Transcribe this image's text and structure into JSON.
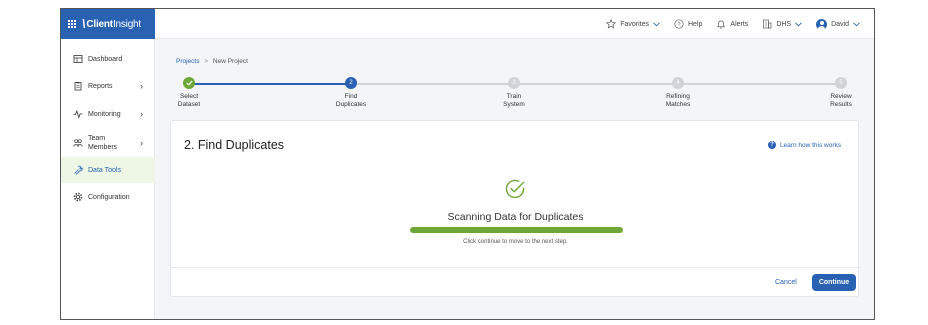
{
  "brand": {
    "name_bold": "Client",
    "name_light": "Insight"
  },
  "topnav": {
    "favorites": "Favorites",
    "help": "Help",
    "alerts": "Alerts",
    "org": "DHS",
    "user": "David"
  },
  "sidebar": {
    "items": [
      {
        "label": "Dashboard"
      },
      {
        "label": "Reports"
      },
      {
        "label": "Monitoring"
      },
      {
        "label_line1": "Team",
        "label_line2": "Members"
      },
      {
        "label": "Data Tools"
      },
      {
        "label": "Configuration"
      }
    ]
  },
  "breadcrumb": {
    "projects": "Projects",
    "sep": ">",
    "current": "New Project"
  },
  "stepper": {
    "steps": [
      {
        "number": "",
        "line1": "Select",
        "line2": "Dataset",
        "state": "done"
      },
      {
        "number": "2",
        "line1": "Find",
        "line2": "Duplicates",
        "state": "current"
      },
      {
        "number": "3",
        "line1": "Train",
        "line2": "System",
        "state": "todo"
      },
      {
        "number": "4",
        "line1": "Refining",
        "line2": "Matches",
        "state": "todo"
      },
      {
        "number": "5",
        "line1": "Review",
        "line2": "Results",
        "state": "todo"
      }
    ]
  },
  "card": {
    "title": "2. Find Duplicates",
    "learn": "Learn how this works",
    "status": "Scanning Data for Duplicates",
    "progress_percent": 100,
    "hint": "Click continue to move to the next step.",
    "cancel": "Cancel",
    "continue": "Continue"
  },
  "colors": {
    "brand": "#2a62b3",
    "success": "#6fa638",
    "inactive": "#d0d3d8"
  }
}
